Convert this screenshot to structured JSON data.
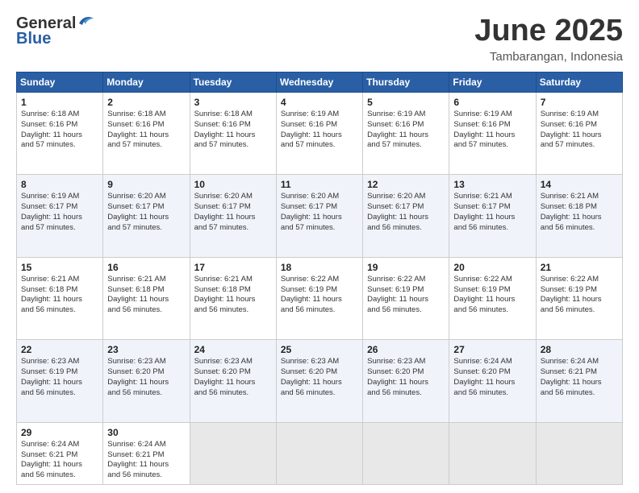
{
  "logo": {
    "general": "General",
    "blue": "Blue"
  },
  "title": "June 2025",
  "location": "Tambarangan, Indonesia",
  "days_of_week": [
    "Sunday",
    "Monday",
    "Tuesday",
    "Wednesday",
    "Thursday",
    "Friday",
    "Saturday"
  ],
  "weeks": [
    [
      {
        "day": "1",
        "sunrise": "6:18 AM",
        "sunset": "6:16 PM",
        "daylight_h": "11",
        "daylight_m": "57"
      },
      {
        "day": "2",
        "sunrise": "6:18 AM",
        "sunset": "6:16 PM",
        "daylight_h": "11",
        "daylight_m": "57"
      },
      {
        "day": "3",
        "sunrise": "6:18 AM",
        "sunset": "6:16 PM",
        "daylight_h": "11",
        "daylight_m": "57"
      },
      {
        "day": "4",
        "sunrise": "6:19 AM",
        "sunset": "6:16 PM",
        "daylight_h": "11",
        "daylight_m": "57"
      },
      {
        "day": "5",
        "sunrise": "6:19 AM",
        "sunset": "6:16 PM",
        "daylight_h": "11",
        "daylight_m": "57"
      },
      {
        "day": "6",
        "sunrise": "6:19 AM",
        "sunset": "6:16 PM",
        "daylight_h": "11",
        "daylight_m": "57"
      },
      {
        "day": "7",
        "sunrise": "6:19 AM",
        "sunset": "6:16 PM",
        "daylight_h": "11",
        "daylight_m": "57"
      }
    ],
    [
      {
        "day": "8",
        "sunrise": "6:19 AM",
        "sunset": "6:17 PM",
        "daylight_h": "11",
        "daylight_m": "57"
      },
      {
        "day": "9",
        "sunrise": "6:20 AM",
        "sunset": "6:17 PM",
        "daylight_h": "11",
        "daylight_m": "57"
      },
      {
        "day": "10",
        "sunrise": "6:20 AM",
        "sunset": "6:17 PM",
        "daylight_h": "11",
        "daylight_m": "57"
      },
      {
        "day": "11",
        "sunrise": "6:20 AM",
        "sunset": "6:17 PM",
        "daylight_h": "11",
        "daylight_m": "57"
      },
      {
        "day": "12",
        "sunrise": "6:20 AM",
        "sunset": "6:17 PM",
        "daylight_h": "11",
        "daylight_m": "56"
      },
      {
        "day": "13",
        "sunrise": "6:21 AM",
        "sunset": "6:17 PM",
        "daylight_h": "11",
        "daylight_m": "56"
      },
      {
        "day": "14",
        "sunrise": "6:21 AM",
        "sunset": "6:18 PM",
        "daylight_h": "11",
        "daylight_m": "56"
      }
    ],
    [
      {
        "day": "15",
        "sunrise": "6:21 AM",
        "sunset": "6:18 PM",
        "daylight_h": "11",
        "daylight_m": "56"
      },
      {
        "day": "16",
        "sunrise": "6:21 AM",
        "sunset": "6:18 PM",
        "daylight_h": "11",
        "daylight_m": "56"
      },
      {
        "day": "17",
        "sunrise": "6:21 AM",
        "sunset": "6:18 PM",
        "daylight_h": "11",
        "daylight_m": "56"
      },
      {
        "day": "18",
        "sunrise": "6:22 AM",
        "sunset": "6:19 PM",
        "daylight_h": "11",
        "daylight_m": "56"
      },
      {
        "day": "19",
        "sunrise": "6:22 AM",
        "sunset": "6:19 PM",
        "daylight_h": "11",
        "daylight_m": "56"
      },
      {
        "day": "20",
        "sunrise": "6:22 AM",
        "sunset": "6:19 PM",
        "daylight_h": "11",
        "daylight_m": "56"
      },
      {
        "day": "21",
        "sunrise": "6:22 AM",
        "sunset": "6:19 PM",
        "daylight_h": "11",
        "daylight_m": "56"
      }
    ],
    [
      {
        "day": "22",
        "sunrise": "6:23 AM",
        "sunset": "6:19 PM",
        "daylight_h": "11",
        "daylight_m": "56"
      },
      {
        "day": "23",
        "sunrise": "6:23 AM",
        "sunset": "6:20 PM",
        "daylight_h": "11",
        "daylight_m": "56"
      },
      {
        "day": "24",
        "sunrise": "6:23 AM",
        "sunset": "6:20 PM",
        "daylight_h": "11",
        "daylight_m": "56"
      },
      {
        "day": "25",
        "sunrise": "6:23 AM",
        "sunset": "6:20 PM",
        "daylight_h": "11",
        "daylight_m": "56"
      },
      {
        "day": "26",
        "sunrise": "6:23 AM",
        "sunset": "6:20 PM",
        "daylight_h": "11",
        "daylight_m": "56"
      },
      {
        "day": "27",
        "sunrise": "6:24 AM",
        "sunset": "6:20 PM",
        "daylight_h": "11",
        "daylight_m": "56"
      },
      {
        "day": "28",
        "sunrise": "6:24 AM",
        "sunset": "6:21 PM",
        "daylight_h": "11",
        "daylight_m": "56"
      }
    ],
    [
      {
        "day": "29",
        "sunrise": "6:24 AM",
        "sunset": "6:21 PM",
        "daylight_h": "11",
        "daylight_m": "56"
      },
      {
        "day": "30",
        "sunrise": "6:24 AM",
        "sunset": "6:21 PM",
        "daylight_h": "11",
        "daylight_m": "56"
      },
      null,
      null,
      null,
      null,
      null
    ]
  ]
}
